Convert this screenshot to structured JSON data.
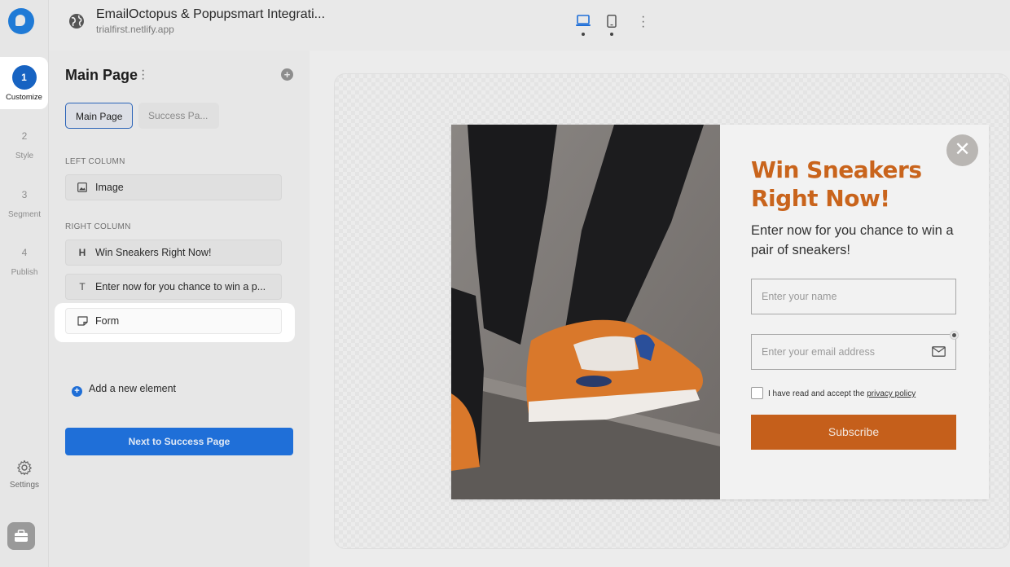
{
  "rail": {
    "steps": [
      {
        "num": "1",
        "label": "Customize",
        "active": true
      },
      {
        "num": "2",
        "label": "Style"
      },
      {
        "num": "3",
        "label": "Segment"
      },
      {
        "num": "4",
        "label": "Publish"
      }
    ],
    "settings_label": "Settings"
  },
  "topbar": {
    "title": "EmailOctopus & Popupsmart Integrati...",
    "url": "trialfirst.netlify.app",
    "devices": [
      "desktop-icon",
      "mobile-icon"
    ]
  },
  "panel": {
    "title": "Main Page",
    "tabs": [
      "Main Page",
      "Success Pa..."
    ],
    "left_column_label": "LEFT COLUMN",
    "left_elements": [
      {
        "icon": "image-icon",
        "label": "Image"
      }
    ],
    "right_column_label": "RIGHT COLUMN",
    "right_elements": [
      {
        "icon": "heading-icon",
        "glyph": "H",
        "label": "Win Sneakers Right Now!"
      },
      {
        "icon": "text-icon",
        "glyph": "T",
        "label": "Enter now for you chance to win a p..."
      },
      {
        "icon": "form-icon",
        "label": "Form"
      }
    ],
    "add_element_label": "Add a new element",
    "next_button": "Next to Success Page"
  },
  "popup": {
    "headline": "Win Sneakers Right Now!",
    "subtext": "Enter now for you chance to win a pair of sneakers!",
    "name_placeholder": "Enter your name",
    "email_placeholder": "Enter your email address",
    "consent_text": "I have read and accept the",
    "privacy_link": "privacy policy",
    "subscribe_label": "Subscribe",
    "close_glyph": "✕"
  },
  "colors": {
    "accent_blue": "#1f6fd8",
    "headline_orange": "#c9641c",
    "button_orange": "#c55f1b"
  }
}
